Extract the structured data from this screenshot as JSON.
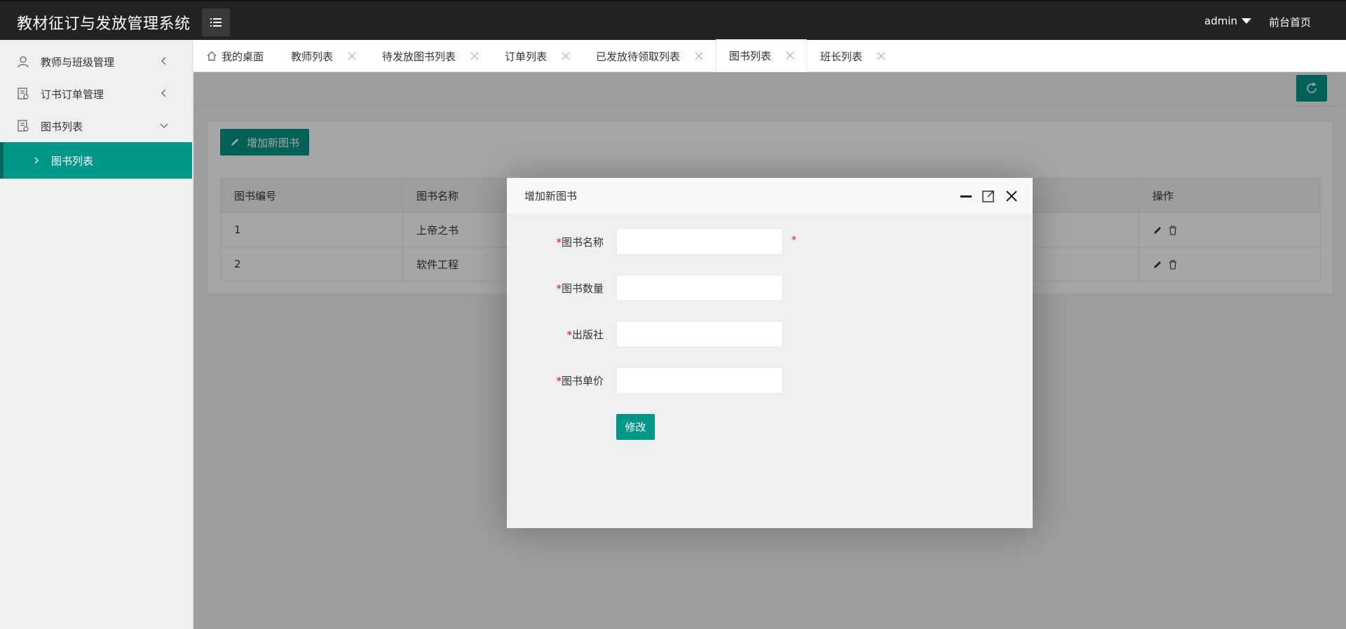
{
  "app": {
    "title": "教材征订与发放管理系统"
  },
  "header": {
    "user": "admin",
    "front_link": "前台首页"
  },
  "sidebar": {
    "items": [
      {
        "label": "教师与班级管理"
      },
      {
        "label": "订书订单管理"
      },
      {
        "label": "图书列表"
      }
    ],
    "sub_items": [
      {
        "label": "图书列表"
      }
    ]
  },
  "tabs": [
    {
      "label": "我的桌面"
    },
    {
      "label": "教师列表"
    },
    {
      "label": "待发放图书列表"
    },
    {
      "label": "订单列表"
    },
    {
      "label": "已发放待领取列表"
    },
    {
      "label": "图书列表"
    },
    {
      "label": "班长列表"
    }
  ],
  "content": {
    "add_button": "增加新图书",
    "table": {
      "headers": [
        "图书编号",
        "图书名称",
        "操作"
      ],
      "rows": [
        {
          "id": "1",
          "name": "上帝之书"
        },
        {
          "id": "2",
          "name": "软件工程"
        }
      ]
    }
  },
  "modal": {
    "title": "增加新图书",
    "fields": [
      {
        "label": "图书名称",
        "value": ""
      },
      {
        "label": "图书数量",
        "value": ""
      },
      {
        "label": "出版社",
        "value": ""
      },
      {
        "label": "图书单价",
        "value": ""
      }
    ],
    "required_mark": "*",
    "submit": "修改"
  },
  "colors": {
    "accent": "#009688",
    "header_bg": "#222222",
    "required": "#ee0000"
  }
}
